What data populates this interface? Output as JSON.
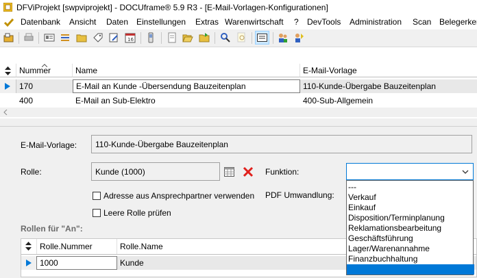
{
  "window": {
    "title": "DFViProjekt [swpviprojekt] - DOCUframe® 5.9 R3 - [E-Mail-Vorlagen-Konfigurationen]"
  },
  "menu": [
    "Datenbank",
    "Ansicht",
    "Daten",
    "Einstellungen",
    "Extras",
    "Warenwirtschaft",
    "?",
    "DevTools",
    "Administration",
    "Scan",
    "Belegerker"
  ],
  "grid": {
    "headers": [
      "Nummer",
      "Name",
      "E-Mail-Vorlage"
    ],
    "rows": [
      {
        "nummer": "170",
        "name": "E-Mail an Kunde -Übersendung Bauzeitenplan",
        "vorlage": "110-Kunde-Übergabe Bauzeitenplan"
      },
      {
        "nummer": "400",
        "name": "E-Mail an Sub-Elektro",
        "vorlage": "400-Sub-Allgemein"
      }
    ]
  },
  "detail": {
    "email_vorlage_label": "E-Mail-Vorlage:",
    "email_vorlage_value": "110-Kunde-Übergabe Bauzeitenplan",
    "rolle_label": "Rolle:",
    "rolle_value": "Kunde (1000)",
    "funktion_label": "Funktion:",
    "checkbox_adresse": "Adresse aus Ansprechpartner verwenden",
    "checkbox_leere": "Leere Rolle prüfen",
    "pdf_label": "PDF Umwandlung:",
    "rollen_an_label": "Rollen für \"An\":"
  },
  "funktion_options": [
    "---",
    "Verkauf",
    "Einkauf",
    "Disposition/Terminplanung",
    "Reklamationsbearbeitung",
    "Geschäftsführung",
    "Lager/Warenannahme",
    "Finanzbuchhaltung",
    ""
  ],
  "subgrid": {
    "headers": [
      "Rolle.Nummer",
      "Rolle.Name"
    ],
    "rows": [
      {
        "nummer": "1000",
        "name": "Kunde"
      }
    ]
  },
  "colors": {
    "accent": "#0078d7",
    "row_highlight": "#e8e8e8",
    "delete_red": "#e0201c"
  }
}
